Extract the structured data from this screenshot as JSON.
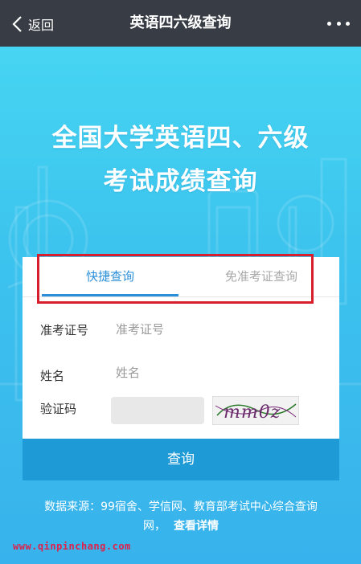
{
  "nav": {
    "back_label": "返回",
    "title": "英语四六级查询",
    "back_icon": "chevron-left-icon",
    "more_icon": "more-dots-icon"
  },
  "hero": {
    "headline_line1": "全国大学英语四、六级",
    "headline_line2": "考试成绩查询"
  },
  "tabs": [
    {
      "label": "快捷查询",
      "active": true
    },
    {
      "label": "免准考证查询",
      "active": false
    }
  ],
  "form": {
    "exam_no_label": "准考证号",
    "exam_no_placeholder": "准考证号",
    "name_label": "姓名",
    "name_placeholder": "姓名",
    "captcha_label": "验证码",
    "captcha_text": "mm0z"
  },
  "submit_label": "查询",
  "footer": {
    "source_line1": "数据来源：99宿舍、学信网、教育部考试中心综合查询",
    "source_line2": "网，",
    "detail_link": "查看详情",
    "watermark": "www.qinpinchang.com"
  },
  "colors": {
    "nav_bg": "#383d45",
    "accent": "#2a8fd8",
    "button": "#1e9ad6",
    "highlight_border": "#d81e2c"
  }
}
